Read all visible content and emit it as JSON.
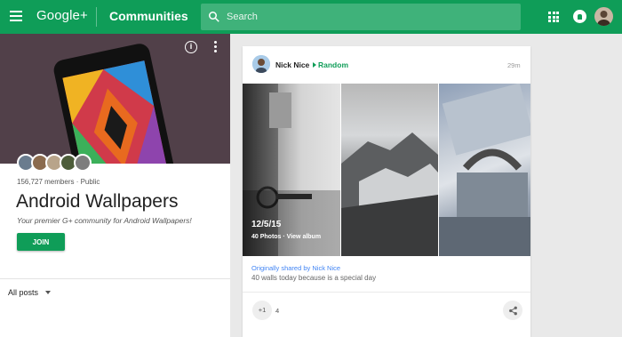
{
  "header": {
    "logo": "Google+",
    "section": "Communities",
    "search_placeholder": "Search"
  },
  "community": {
    "members": "156,727 members · Public",
    "name": "Android Wallpapers",
    "tagline": "Your premier G+ community for Android Wallpapers!",
    "join_label": "JOIN",
    "filter_label": "All posts"
  },
  "post": {
    "author": "Nick Nice",
    "category": "Random",
    "time": "29m",
    "album_date": "12/5/15",
    "album_link": "40 Photos · View album",
    "shared_by": "Originally shared by Nick Nice",
    "text": "40 walls today because is a special day",
    "plus_label": "+1",
    "plus_count": "4"
  },
  "colors": {
    "brand_green": "#0f9d58",
    "link_blue": "#4285f4"
  },
  "icons": [
    "menu-icon",
    "search-icon",
    "apps-icon",
    "notifications-icon",
    "info-icon",
    "more-vert-icon",
    "chevron-down-icon",
    "share-icon"
  ]
}
